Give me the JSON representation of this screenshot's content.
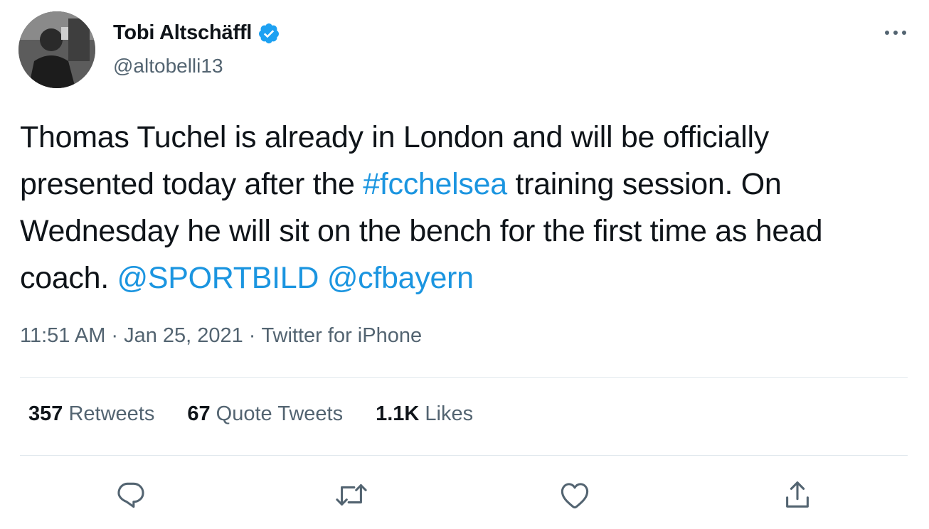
{
  "author": {
    "name": "Tobi Altschäffl",
    "handle": "@altobelli13",
    "verified": true
  },
  "tweet": {
    "text_1": "Thomas Tuchel is already in London and will be officially presented today after the ",
    "hashtag": "#fcchelsea",
    "text_2": " training session. On Wednesday he will sit on the bench for the first time as head coach. ",
    "mention_1": "@SPORTBILD",
    "space": " ",
    "mention_2": "@cfbayern"
  },
  "meta": {
    "time": "11:51 AM",
    "separator": "·",
    "date": "Jan 25, 2021",
    "source": "Twitter for iPhone"
  },
  "stats": {
    "retweets": {
      "count": "357",
      "label": "Retweets"
    },
    "quotes": {
      "count": "67",
      "label": "Quote Tweets"
    },
    "likes": {
      "count": "1.1K",
      "label": "Likes"
    }
  },
  "colors": {
    "link": "#1b95e0",
    "verified": "#1da1f2",
    "secondary_text": "#536471",
    "divider": "#e1e8ed"
  },
  "icons": {
    "reply": "reply-icon",
    "retweet": "retweet-icon",
    "like": "heart-icon",
    "share": "share-icon",
    "more": "more-icon",
    "verified": "verified-badge-icon"
  }
}
